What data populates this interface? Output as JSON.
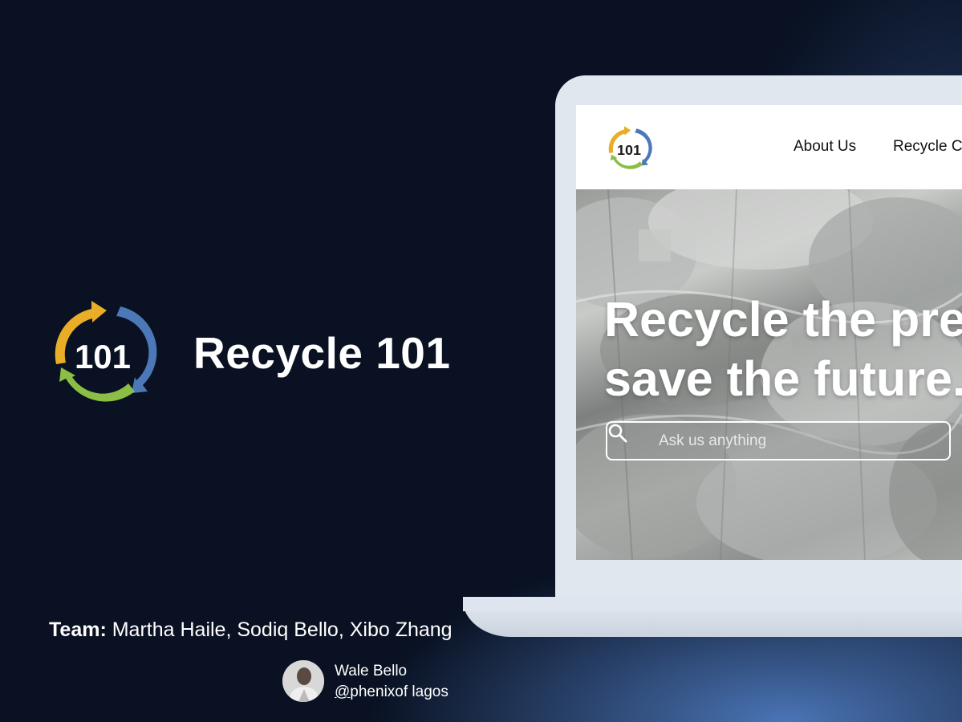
{
  "brand": {
    "title": "Recycle 101",
    "logo_text": "101",
    "logo_colors": {
      "yellow": "#E9AD27",
      "blue": "#4C78B8",
      "green": "#8BBE45",
      "text": "#1A1A1A"
    }
  },
  "team": {
    "label": "Team:",
    "members": "Martha Haile, Sodiq Bello, Xibo Zhang"
  },
  "author": {
    "name": "Wale Bello",
    "handle_at": "@",
    "handle_rest": "phenixof lagos"
  },
  "website": {
    "nav": {
      "logo_text": "101",
      "links": [
        {
          "label": "About Us"
        },
        {
          "label": "Recycle Ca"
        }
      ]
    },
    "hero": {
      "title_line1": "Recycle the pres",
      "title_line2": "save the future.",
      "search_placeholder": "Ask us anything"
    }
  }
}
